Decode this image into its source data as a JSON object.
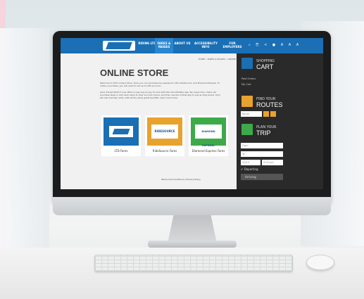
{
  "nav": {
    "items": [
      "RIDING LTD",
      "FARES & PASSES",
      "ABOUT US",
      "ACCESSIBILITY INFO",
      "FOR EMPLOYERS"
    ],
    "active_index": 1,
    "language": "A A A"
  },
  "breadcrumb": "HOME  •  FARES & PASSES  •  ONLINE STORE",
  "page": {
    "title": "ONLINE STORE",
    "intro": "Welcome to LTD's Online Store. Here you can purchase bus passes for LTD, RideSource, and Diamond Express. To make a purchase, you will need to set up an LTD account.",
    "mobility": "Lane Transit District now offers a new way to pay for bus with the Umo Mobility app. By using Umo, riders can purchase fares or add cash value to their account online, and then use the mobile app to pay as they board. Umo will also fuel tap cards, with all the same great benefits. Learn more here."
  },
  "cards": [
    {
      "label": "LTD Fares",
      "logo": "LTD"
    },
    {
      "label": "RideSource Fares",
      "logo": "RIDESOURCE"
    },
    {
      "label": "Diamond Express Fares",
      "logo": "DIAMOND EXPRESS"
    }
  ],
  "footer": "Terms and Conditions  |  Privacy Policy",
  "sidebar": {
    "cart": {
      "small": "SHOPPING",
      "big": "CART",
      "links": [
        "Past Orders",
        "My Cart"
      ]
    },
    "routes": {
      "small": "FIND YOUR",
      "big": "ROUTES",
      "select": "Route"
    },
    "trip": {
      "small": "PLAN YOUR",
      "big": "TRIP",
      "from": "From",
      "to": "To",
      "date": "12/13",
      "time": "5:09 pm",
      "departing": "Departing",
      "arriving": "Arriving"
    }
  },
  "colors": {
    "nav": "#1a6fb5",
    "cart": "#1a6fb5",
    "routes": "#e8a22e",
    "trip": "#3daa4a"
  }
}
